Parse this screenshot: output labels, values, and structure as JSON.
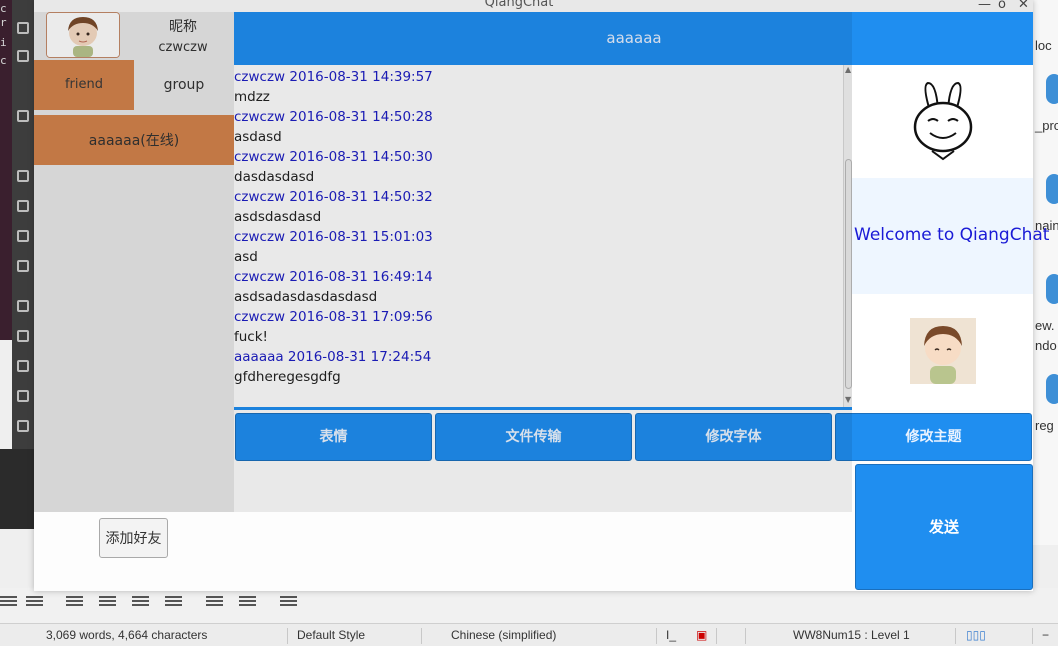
{
  "window": {
    "title": "QiangChat"
  },
  "profile": {
    "nick_label": "昵称",
    "username": "czwczw"
  },
  "tabs": {
    "friend": "friend",
    "group": "group"
  },
  "friends": [
    {
      "label": "aaaaaa(在线)"
    }
  ],
  "add_friend_label": "添加好友",
  "chat": {
    "title": "aaaaaa",
    "messages": [
      {
        "header": "czwczw 2016-08-31 14:39:57",
        "body": "mdzz"
      },
      {
        "header": "czwczw 2016-08-31 14:50:28",
        "body": "asdasd"
      },
      {
        "header": "czwczw 2016-08-31 14:50:30",
        "body": "dasdasdasd"
      },
      {
        "header": "czwczw 2016-08-31 14:50:32",
        "body": "asdsdasdasd"
      },
      {
        "header": "czwczw 2016-08-31 15:01:03",
        "body": "asd"
      },
      {
        "header": "czwczw 2016-08-31 16:49:14",
        "body": "asdsadasdasdasdasd"
      },
      {
        "header": "czwczw 2016-08-31 17:09:56",
        "body": "fuck!"
      },
      {
        "header": "aaaaaa 2016-08-31 17:24:54",
        "body": "gfdheregesgdfg"
      }
    ]
  },
  "toolbar": {
    "emoji": "表情",
    "file_transfer": "文件传输",
    "change_font": "修改字体",
    "change_theme": "修改主题"
  },
  "send_label": "发送",
  "welcome": "Welcome to QiangChat",
  "colors": {
    "accent": "#1f8ef0",
    "selected": "#d3834b",
    "header_text": "#1d1ec4"
  },
  "background": {
    "right_labels": [
      "loc",
      "_pro",
      "nain",
      "ew.",
      "ndo",
      "reg"
    ],
    "status": {
      "words": "3,069 words, 4,664 characters",
      "style": "Default Style",
      "language": "Chinese (simplified)",
      "list_style": "WW8Num15 : Level 1"
    }
  }
}
